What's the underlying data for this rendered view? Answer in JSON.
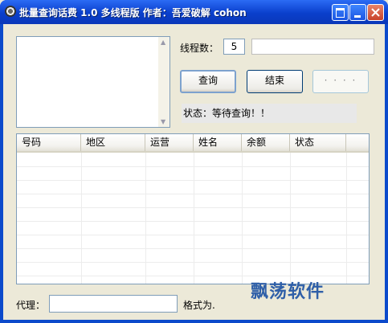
{
  "window": {
    "title": "批量查询话费 1.0 多线程版 作者：吾爱破解 cohon"
  },
  "controls": {
    "thread_label": "线程数：",
    "thread_value": "5",
    "query_button": "查询",
    "stop_button": "结束",
    "blank_button": "· · · ·",
    "status_text": "状态：等待查询！！"
  },
  "table": {
    "columns": [
      "号码",
      "地区",
      "运营",
      "姓名",
      "余额",
      "状态"
    ],
    "rows": []
  },
  "footer": {
    "proxy_label": "代理：",
    "proxy_value": "",
    "format_label": "格式为."
  },
  "watermark": "飘荡软件"
}
